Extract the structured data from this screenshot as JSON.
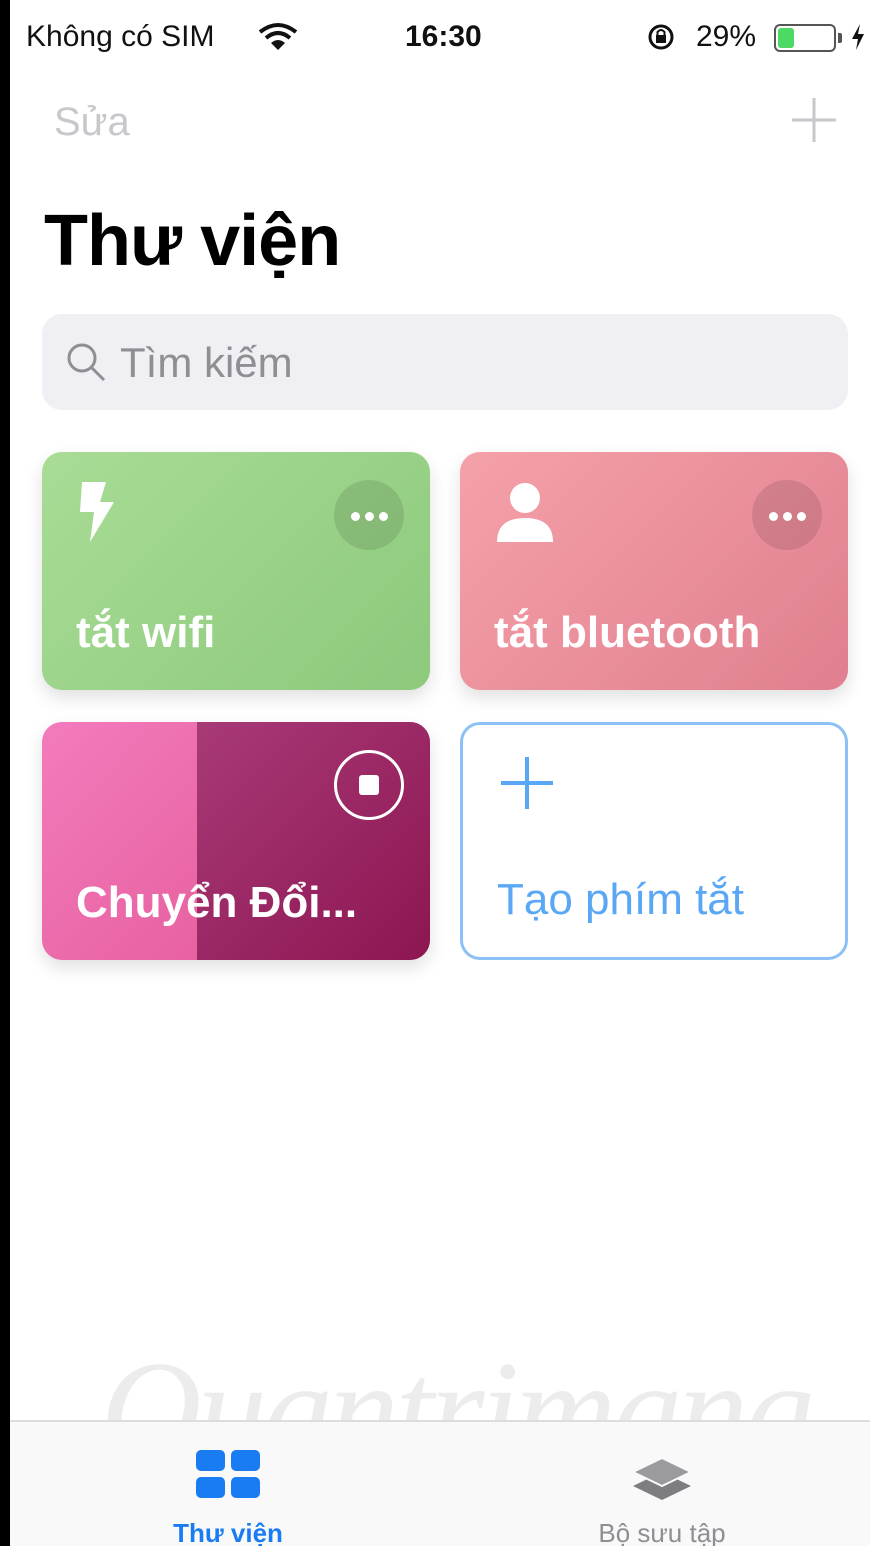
{
  "status_bar": {
    "carrier": "Không có SIM",
    "time": "16:30",
    "battery_percent": "29%",
    "battery_level": 0.29
  },
  "nav": {
    "edit_label": "Sửa",
    "add_icon": "plus-icon"
  },
  "page_title": "Thư viện",
  "search": {
    "placeholder": "Tìm kiếm",
    "icon": "search-icon"
  },
  "shortcuts": [
    {
      "label": "tắt wifi",
      "icon": "bolt-icon",
      "color": "#9ed38a"
    },
    {
      "label": "tắt bluetooth",
      "icon": "person-icon",
      "color": "#eb8f9c"
    },
    {
      "label": "Chuyển Đổi...",
      "icon": "stop-icon",
      "color": "#c9307a"
    },
    {
      "label": "Tạo phím tắt",
      "icon": "plus-icon",
      "color": "#5aa8f5"
    }
  ],
  "watermark": "Quantrimang",
  "tab_bar": {
    "tabs": [
      {
        "label": "Thư viện",
        "icon": "grid-icon",
        "active": true,
        "color": "#1a7cf2"
      },
      {
        "label": "Bộ sưu tập",
        "icon": "layers-icon",
        "active": false
      }
    ]
  }
}
